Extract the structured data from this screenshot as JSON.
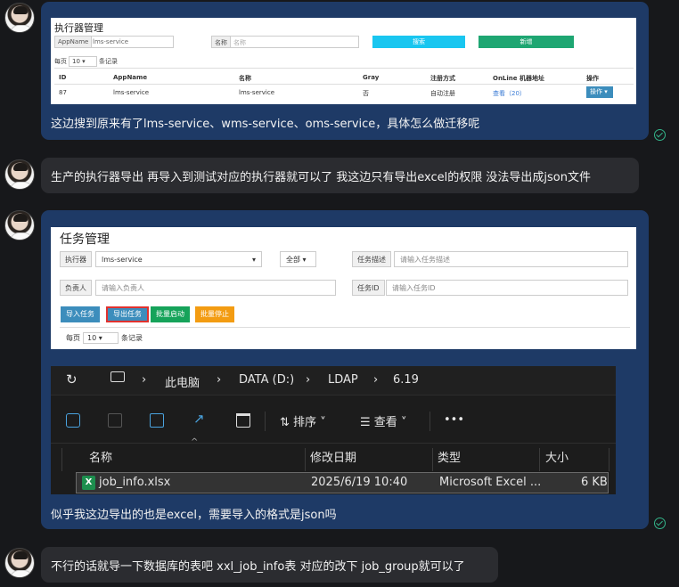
{
  "messages": [
    {
      "text": "这边搜到原来有了lms-service、wms-service、oms-service，具体怎么做迁移呢"
    },
    {
      "text": "生产的执行器导出 再导入到测试对应的执行器就可以了 我这边只有导出excel的权限 没法导出成json文件"
    },
    {
      "text": "似乎我这边导出的也是excel，需要导入的格式是json吗"
    },
    {
      "text": "不行的话就导一下数据库的表吧 xxl_job_info表 对应的改下 job_group就可以了"
    }
  ],
  "shot1": {
    "title": "执行器管理",
    "appname_label": "AppName",
    "appname_value": "lms-service",
    "name_label": "名称",
    "name_placeholder": "名称",
    "search_btn": "搜索",
    "add_btn": "新增",
    "per_page": "每页",
    "per_page_value": "10",
    "records": "条记录",
    "headers": [
      "ID",
      "AppName",
      "名称",
      "Gray",
      "注册方式",
      "OnLine 机器地址",
      "操作"
    ],
    "row": [
      "87",
      "lms-service",
      "lms-service",
      "否",
      "自动注册",
      "查看（20）",
      "操作"
    ]
  },
  "shot2": {
    "title": "任务管理",
    "executor_label": "执行器",
    "executor_value": "lms-service",
    "status_value": "全部",
    "desc_label": "任务描述",
    "desc_placeholder": "请输入任务描述",
    "owner_label": "负责人",
    "owner_placeholder": "请输入负责人",
    "taskid_label": "任务ID",
    "taskid_placeholder": "请输入任务ID",
    "btn_import": "导入任务",
    "btn_export": "导出任务",
    "btn_batch_start": "批量启动",
    "btn_batch_stop": "批量停止",
    "per_page": "每页",
    "per_page_value": "10",
    "records": "条记录"
  },
  "explorer": {
    "breadcrumb": [
      "此电脑",
      "DATA (D:)",
      "LDAP",
      "6.19"
    ],
    "sort_label": "排序",
    "view_label": "查看",
    "more": "•••",
    "columns": [
      "名称",
      "修改日期",
      "类型",
      "大小"
    ],
    "file": {
      "name": "job_info.xlsx",
      "date": "2025/6/19 10:40",
      "type": "Microsoft Excel ...",
      "size": "6 KB"
    }
  },
  "colors": {
    "bubble_blue": "#1e3a66",
    "bubble_gray": "#2b2c30",
    "accent_cyan": "#19c6f0",
    "accent_green": "#1ea672"
  }
}
